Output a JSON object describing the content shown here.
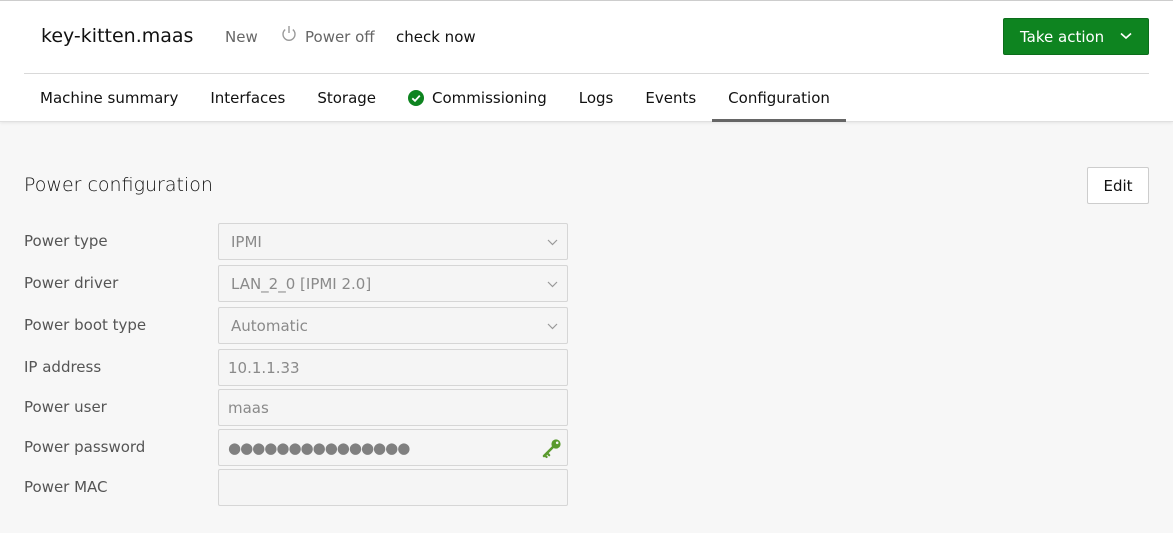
{
  "header": {
    "machine_name": "key-kitten.maas",
    "status": "New",
    "power_status": "Power off",
    "check_now": "check now",
    "take_action_label": "Take action",
    "accent_color": "#0e8420"
  },
  "tabs": [
    {
      "label": "Machine summary",
      "active": false
    },
    {
      "label": "Interfaces",
      "active": false
    },
    {
      "label": "Storage",
      "active": false
    },
    {
      "label": "Commissioning",
      "active": false,
      "icon": "success-check-icon",
      "icon_color": "#0e8420"
    },
    {
      "label": "Logs",
      "active": false
    },
    {
      "label": "Events",
      "active": false
    },
    {
      "label": "Configuration",
      "active": true
    }
  ],
  "power_config": {
    "title": "Power configuration",
    "edit_label": "Edit",
    "fields": {
      "power_type": {
        "label": "Power type",
        "value": "IPMI"
      },
      "power_driver": {
        "label": "Power driver",
        "value": "LAN_2_0 [IPMI 2.0]"
      },
      "power_boot_type": {
        "label": "Power boot type",
        "value": "Automatic"
      },
      "ip_address": {
        "label": "IP address",
        "value": "10.1.1.33"
      },
      "power_user": {
        "label": "Power user",
        "value": "maas"
      },
      "power_password": {
        "label": "Power password",
        "value": "●●●●●●●●●●●●●●●",
        "icon": "key-icon",
        "icon_color": "#5a9a2e"
      },
      "power_mac": {
        "label": "Power MAC",
        "value": ""
      }
    }
  }
}
